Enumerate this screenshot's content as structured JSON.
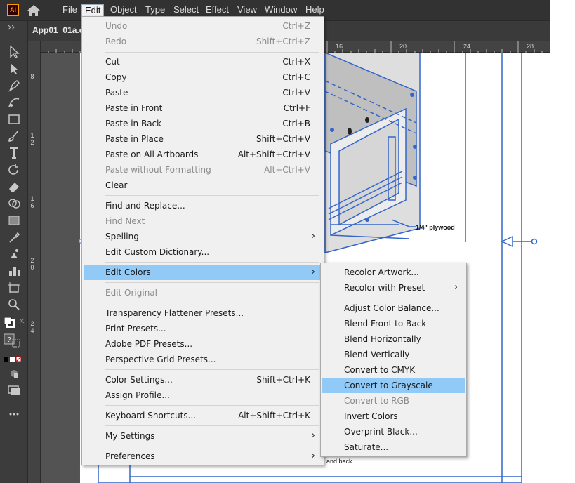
{
  "app": {
    "logo": "Ai",
    "document_tab": "App01_01a.e"
  },
  "menubar": {
    "items": [
      "File",
      "Edit",
      "Object",
      "Type",
      "Select",
      "Effect",
      "View",
      "Window",
      "Help"
    ],
    "active": "Edit"
  },
  "ruler": {
    "h_labels": [
      "16",
      "20",
      "24",
      "28"
    ],
    "v_labels": [
      "8",
      "1 2",
      "1 6",
      "2 0",
      "2 4"
    ]
  },
  "canvas": {
    "plywood_note": "1/4\" plywood",
    "bottom_note": "and back"
  },
  "edit_menu": {
    "items": [
      {
        "label": "Undo",
        "shortcut": "Ctrl+Z",
        "disabled": true
      },
      {
        "label": "Redo",
        "shortcut": "Shift+Ctrl+Z",
        "disabled": true
      },
      {
        "label": "Cut",
        "shortcut": "Ctrl+X"
      },
      {
        "label": "Copy",
        "shortcut": "Ctrl+C"
      },
      {
        "label": "Paste",
        "shortcut": "Ctrl+V"
      },
      {
        "label": "Paste in Front",
        "shortcut": "Ctrl+F"
      },
      {
        "label": "Paste in Back",
        "shortcut": "Ctrl+B"
      },
      {
        "label": "Paste in Place",
        "shortcut": "Shift+Ctrl+V"
      },
      {
        "label": "Paste on All Artboards",
        "shortcut": "Alt+Shift+Ctrl+V"
      },
      {
        "label": "Paste without Formatting",
        "shortcut": "Alt+Ctrl+V",
        "disabled": true
      },
      {
        "label": "Clear",
        "shortcut": ""
      },
      {
        "label": "Find and Replace...",
        "shortcut": ""
      },
      {
        "label": "Find Next",
        "shortcut": "",
        "disabled": true
      },
      {
        "label": "Spelling",
        "shortcut": "",
        "submenu": true
      },
      {
        "label": "Edit Custom Dictionary...",
        "shortcut": ""
      },
      {
        "label": "Edit Colors",
        "shortcut": "",
        "submenu": true,
        "highlighted": true
      },
      {
        "label": "Edit Original",
        "shortcut": "",
        "disabled": true
      },
      {
        "label": "Transparency Flattener Presets...",
        "shortcut": ""
      },
      {
        "label": "Print Presets...",
        "shortcut": ""
      },
      {
        "label": "Adobe PDF Presets...",
        "shortcut": ""
      },
      {
        "label": "Perspective Grid Presets...",
        "shortcut": ""
      },
      {
        "label": "Color Settings...",
        "shortcut": "Shift+Ctrl+K"
      },
      {
        "label": "Assign Profile...",
        "shortcut": ""
      },
      {
        "label": "Keyboard Shortcuts...",
        "shortcut": "Alt+Shift+Ctrl+K"
      },
      {
        "label": "My Settings",
        "shortcut": "",
        "submenu": true
      },
      {
        "label": "Preferences",
        "shortcut": "",
        "submenu": true
      }
    ]
  },
  "edit_colors_submenu": {
    "items": [
      {
        "label": "Recolor Artwork..."
      },
      {
        "label": "Recolor with Preset",
        "submenu": true
      },
      {
        "label": "Adjust Color Balance..."
      },
      {
        "label": "Blend Front to Back"
      },
      {
        "label": "Blend Horizontally"
      },
      {
        "label": "Blend Vertically"
      },
      {
        "label": "Convert to CMYK"
      },
      {
        "label": "Convert to Grayscale",
        "highlighted": true
      },
      {
        "label": "Convert to RGB",
        "disabled": true
      },
      {
        "label": "Invert Colors"
      },
      {
        "label": "Overprint Black..."
      },
      {
        "label": "Saturate..."
      }
    ]
  },
  "colors": {
    "menu_highlight": "#91c9f7",
    "selection_blue": "#3366cc",
    "logo_orange": "#ff9a00"
  }
}
